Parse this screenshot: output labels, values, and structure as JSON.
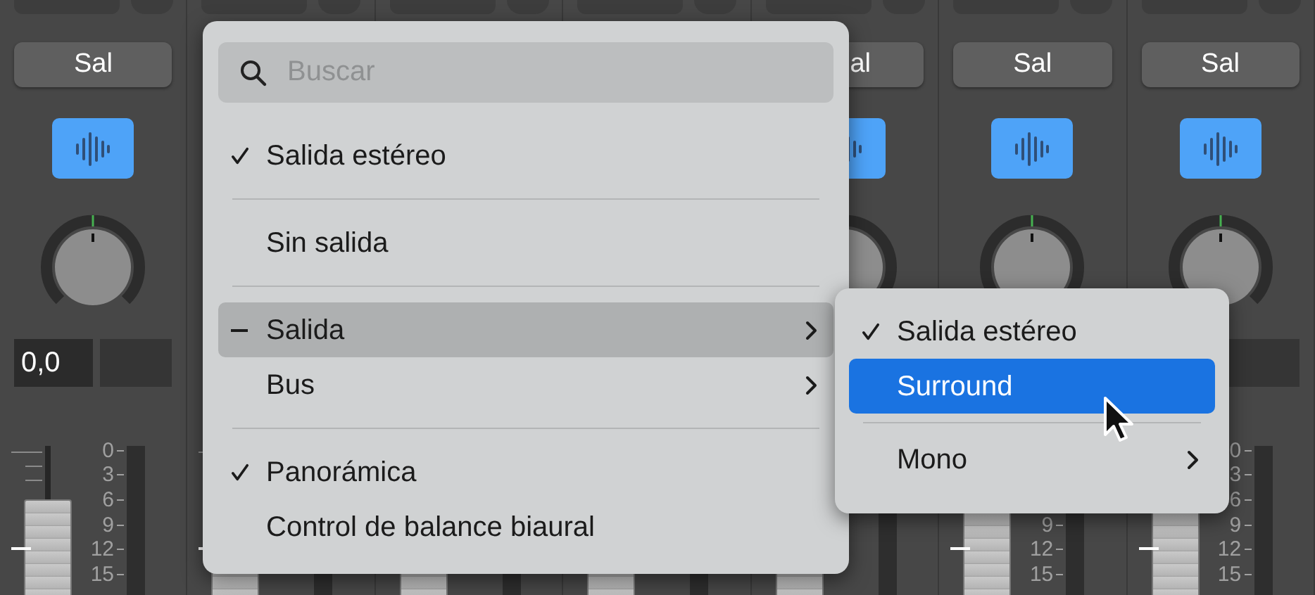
{
  "strips": [
    {
      "kind": "channel",
      "label": "Sal",
      "value": "0,0",
      "scale": [
        "0",
        "3",
        "6",
        "9",
        "12",
        "15"
      ]
    },
    {
      "kind": "covered"
    },
    {
      "kind": "covered"
    },
    {
      "kind": "covered"
    },
    {
      "kind": "channel",
      "label": "al",
      "clipped": true
    },
    {
      "kind": "channel",
      "label": "Sal",
      "scale": [
        "9",
        "12",
        "15"
      ]
    },
    {
      "kind": "channel",
      "label": "Sal",
      "scale": [
        "0",
        "3",
        "6",
        "9",
        "12",
        "15"
      ]
    }
  ],
  "menu": {
    "search": {
      "placeholder": "Buscar"
    },
    "items": [
      {
        "kind": "item",
        "label": "Salida estéreo",
        "checked": true,
        "mixed": false,
        "selected": false,
        "submenu": false
      },
      {
        "kind": "separator"
      },
      {
        "kind": "item",
        "label": "Sin salida",
        "checked": false,
        "mixed": false,
        "selected": false,
        "submenu": false
      },
      {
        "kind": "separator"
      },
      {
        "kind": "item",
        "label": "Salida",
        "checked": false,
        "mixed": true,
        "selected": true,
        "submenu": true
      },
      {
        "kind": "item",
        "label": "Bus",
        "checked": false,
        "mixed": false,
        "selected": false,
        "submenu": true
      },
      {
        "kind": "separator"
      },
      {
        "kind": "item",
        "label": "Panorámica",
        "checked": true,
        "mixed": false,
        "selected": false,
        "submenu": false
      },
      {
        "kind": "item",
        "label": "Control de balance biaural",
        "checked": false,
        "mixed": false,
        "selected": false,
        "submenu": false
      }
    ]
  },
  "submenu": {
    "items": [
      {
        "kind": "item",
        "label": "Salida estéreo",
        "checked": true,
        "mixed": false,
        "selected": false,
        "submenu": false
      },
      {
        "kind": "item",
        "label": "Surround",
        "checked": false,
        "mixed": false,
        "selected": true,
        "submenu": false
      },
      {
        "kind": "separator"
      },
      {
        "kind": "item",
        "label": "Mono",
        "checked": false,
        "mixed": false,
        "selected": false,
        "submenu": true
      }
    ]
  }
}
